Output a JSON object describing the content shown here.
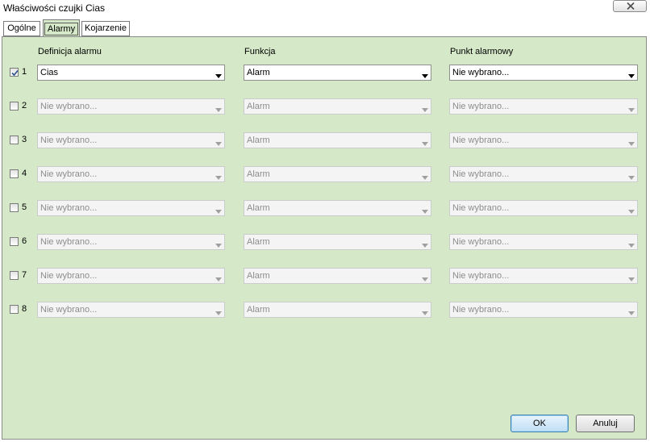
{
  "window": {
    "title": "Właściwości czujki Cias"
  },
  "tabs": [
    {
      "label": "Ogólne",
      "active": false
    },
    {
      "label": "Alarmy",
      "active": true
    },
    {
      "label": "Kojarzenie",
      "active": false
    }
  ],
  "columns": {
    "definition": "Definicja alarmu",
    "function": "Funkcja",
    "alarm_point": "Punkt alarmowy"
  },
  "rows": [
    {
      "num": "1",
      "checked": true,
      "definition": "Cias",
      "function": "Alarm",
      "alarm_point": "Nie wybrano...",
      "enabled": true
    },
    {
      "num": "2",
      "checked": false,
      "definition": "Nie wybrano...",
      "function": "Alarm",
      "alarm_point": "Nie wybrano...",
      "enabled": false
    },
    {
      "num": "3",
      "checked": false,
      "definition": "Nie wybrano...",
      "function": "Alarm",
      "alarm_point": "Nie wybrano...",
      "enabled": false
    },
    {
      "num": "4",
      "checked": false,
      "definition": "Nie wybrano...",
      "function": "Alarm",
      "alarm_point": "Nie wybrano...",
      "enabled": false
    },
    {
      "num": "5",
      "checked": false,
      "definition": "Nie wybrano...",
      "function": "Alarm",
      "alarm_point": "Nie wybrano...",
      "enabled": false
    },
    {
      "num": "6",
      "checked": false,
      "definition": "Nie wybrano...",
      "function": "Alarm",
      "alarm_point": "Nie wybrano...",
      "enabled": false
    },
    {
      "num": "7",
      "checked": false,
      "definition": "Nie wybrano...",
      "function": "Alarm",
      "alarm_point": "Nie wybrano...",
      "enabled": false
    },
    {
      "num": "8",
      "checked": false,
      "definition": "Nie wybrano...",
      "function": "Alarm",
      "alarm_point": "Nie wybrano...",
      "enabled": false
    }
  ],
  "buttons": {
    "ok": "OK",
    "cancel": "Anuluj"
  },
  "icons": {
    "close": "close-icon",
    "dropdown": "chevron-down-icon",
    "check": "checkmark-icon"
  },
  "colors": {
    "panel_bg": "#d5e8c8",
    "default_button_border": "#3c7fb1"
  }
}
